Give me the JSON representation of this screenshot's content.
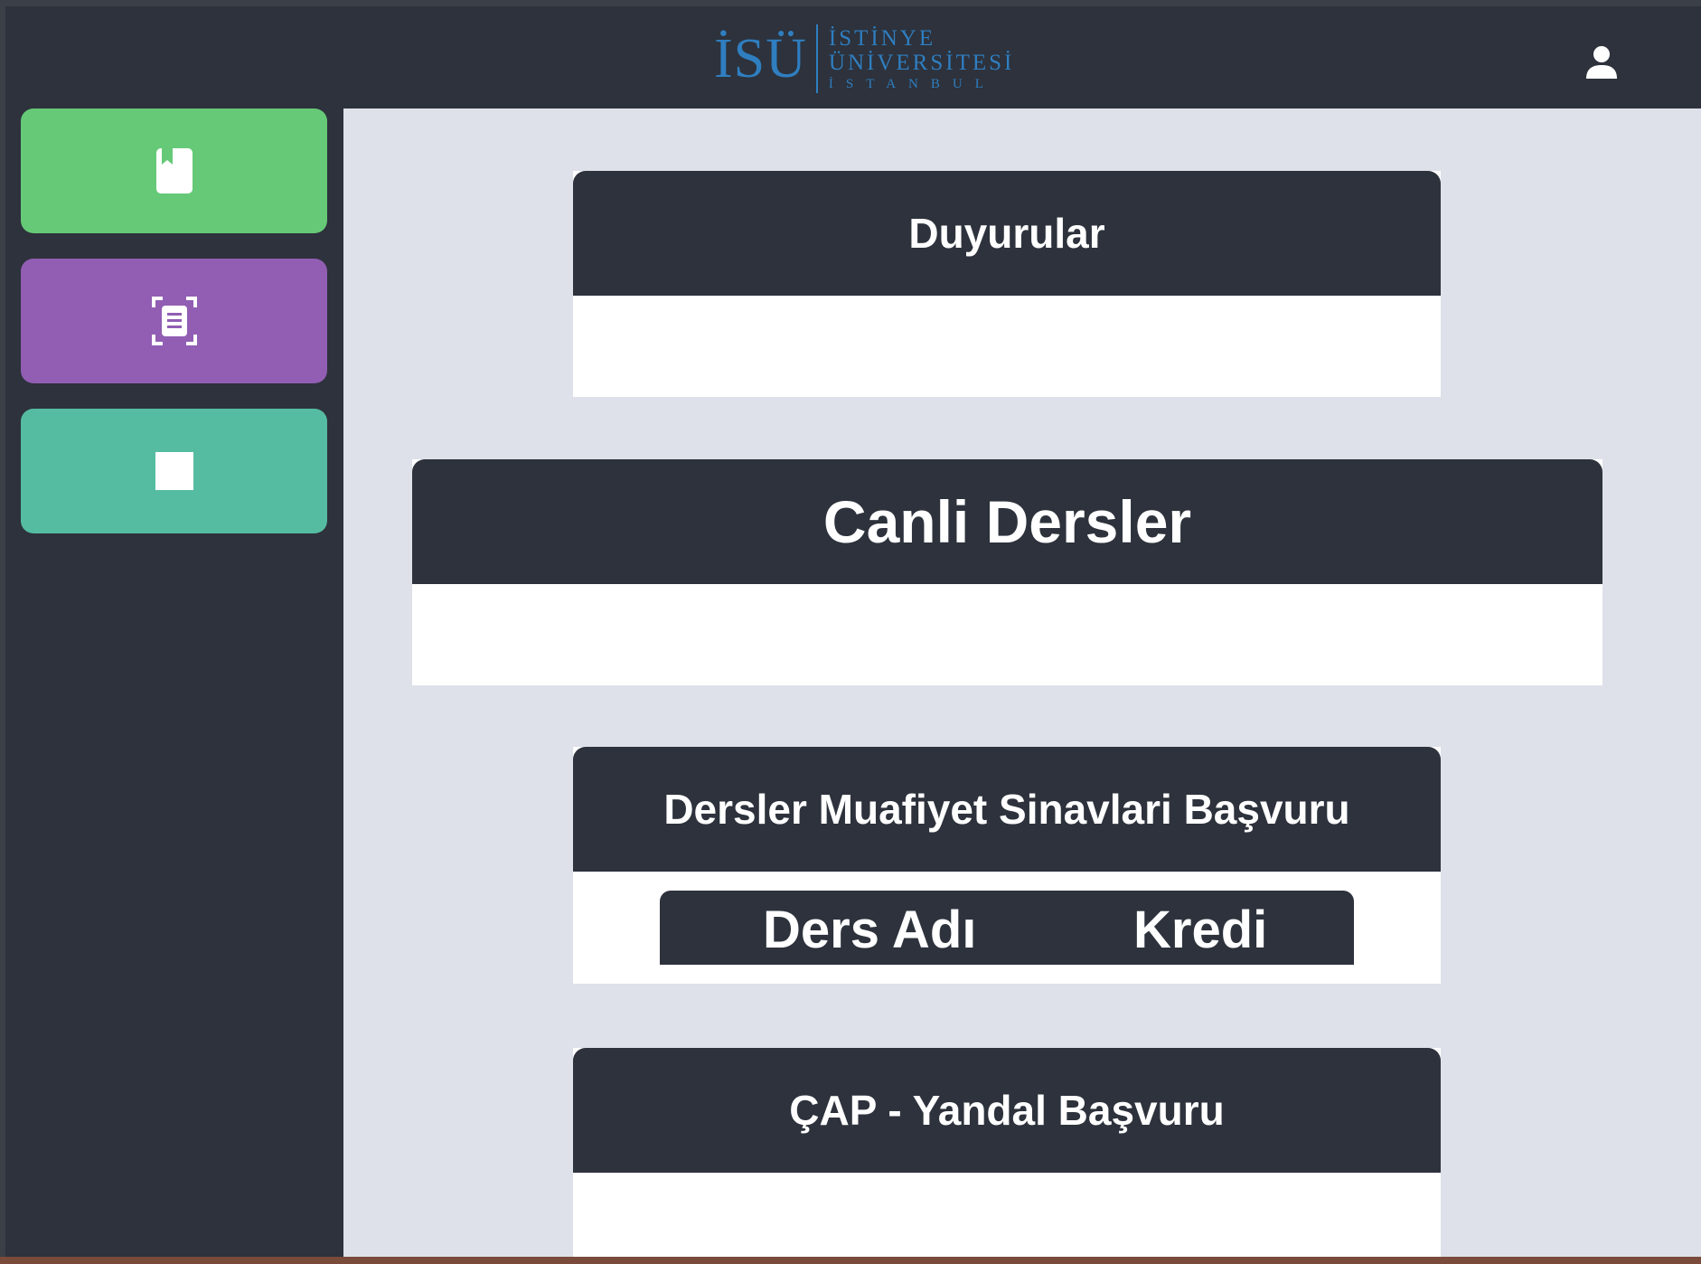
{
  "header": {
    "logo": {
      "mark": "İSÜ",
      "line1": "İSTİNYE",
      "line2": "ÜNİVERSİTESİ",
      "line3": "İSTANBUL"
    },
    "user_icon": "user-icon"
  },
  "sidebar": {
    "items": [
      {
        "icon": "book-icon",
        "color": "#66c977"
      },
      {
        "icon": "document-scan-icon",
        "color": "#915eb3"
      },
      {
        "icon": "square-icon",
        "color": "#55bca1"
      }
    ]
  },
  "main": {
    "cards": {
      "duyurular": {
        "title": "Duyurular"
      },
      "canli": {
        "title": "Canli Dersler"
      },
      "muafiyet": {
        "title": "Dersler Muafiyet Sinavlari Başvuru",
        "columns": [
          "Ders Adı",
          "Kredi"
        ]
      },
      "cap": {
        "title": "ÇAP - Yandal Başvuru"
      }
    }
  },
  "colors": {
    "background": "#2d323c",
    "content": "#dee1e9",
    "brand_blue": "#2f7ec0"
  }
}
